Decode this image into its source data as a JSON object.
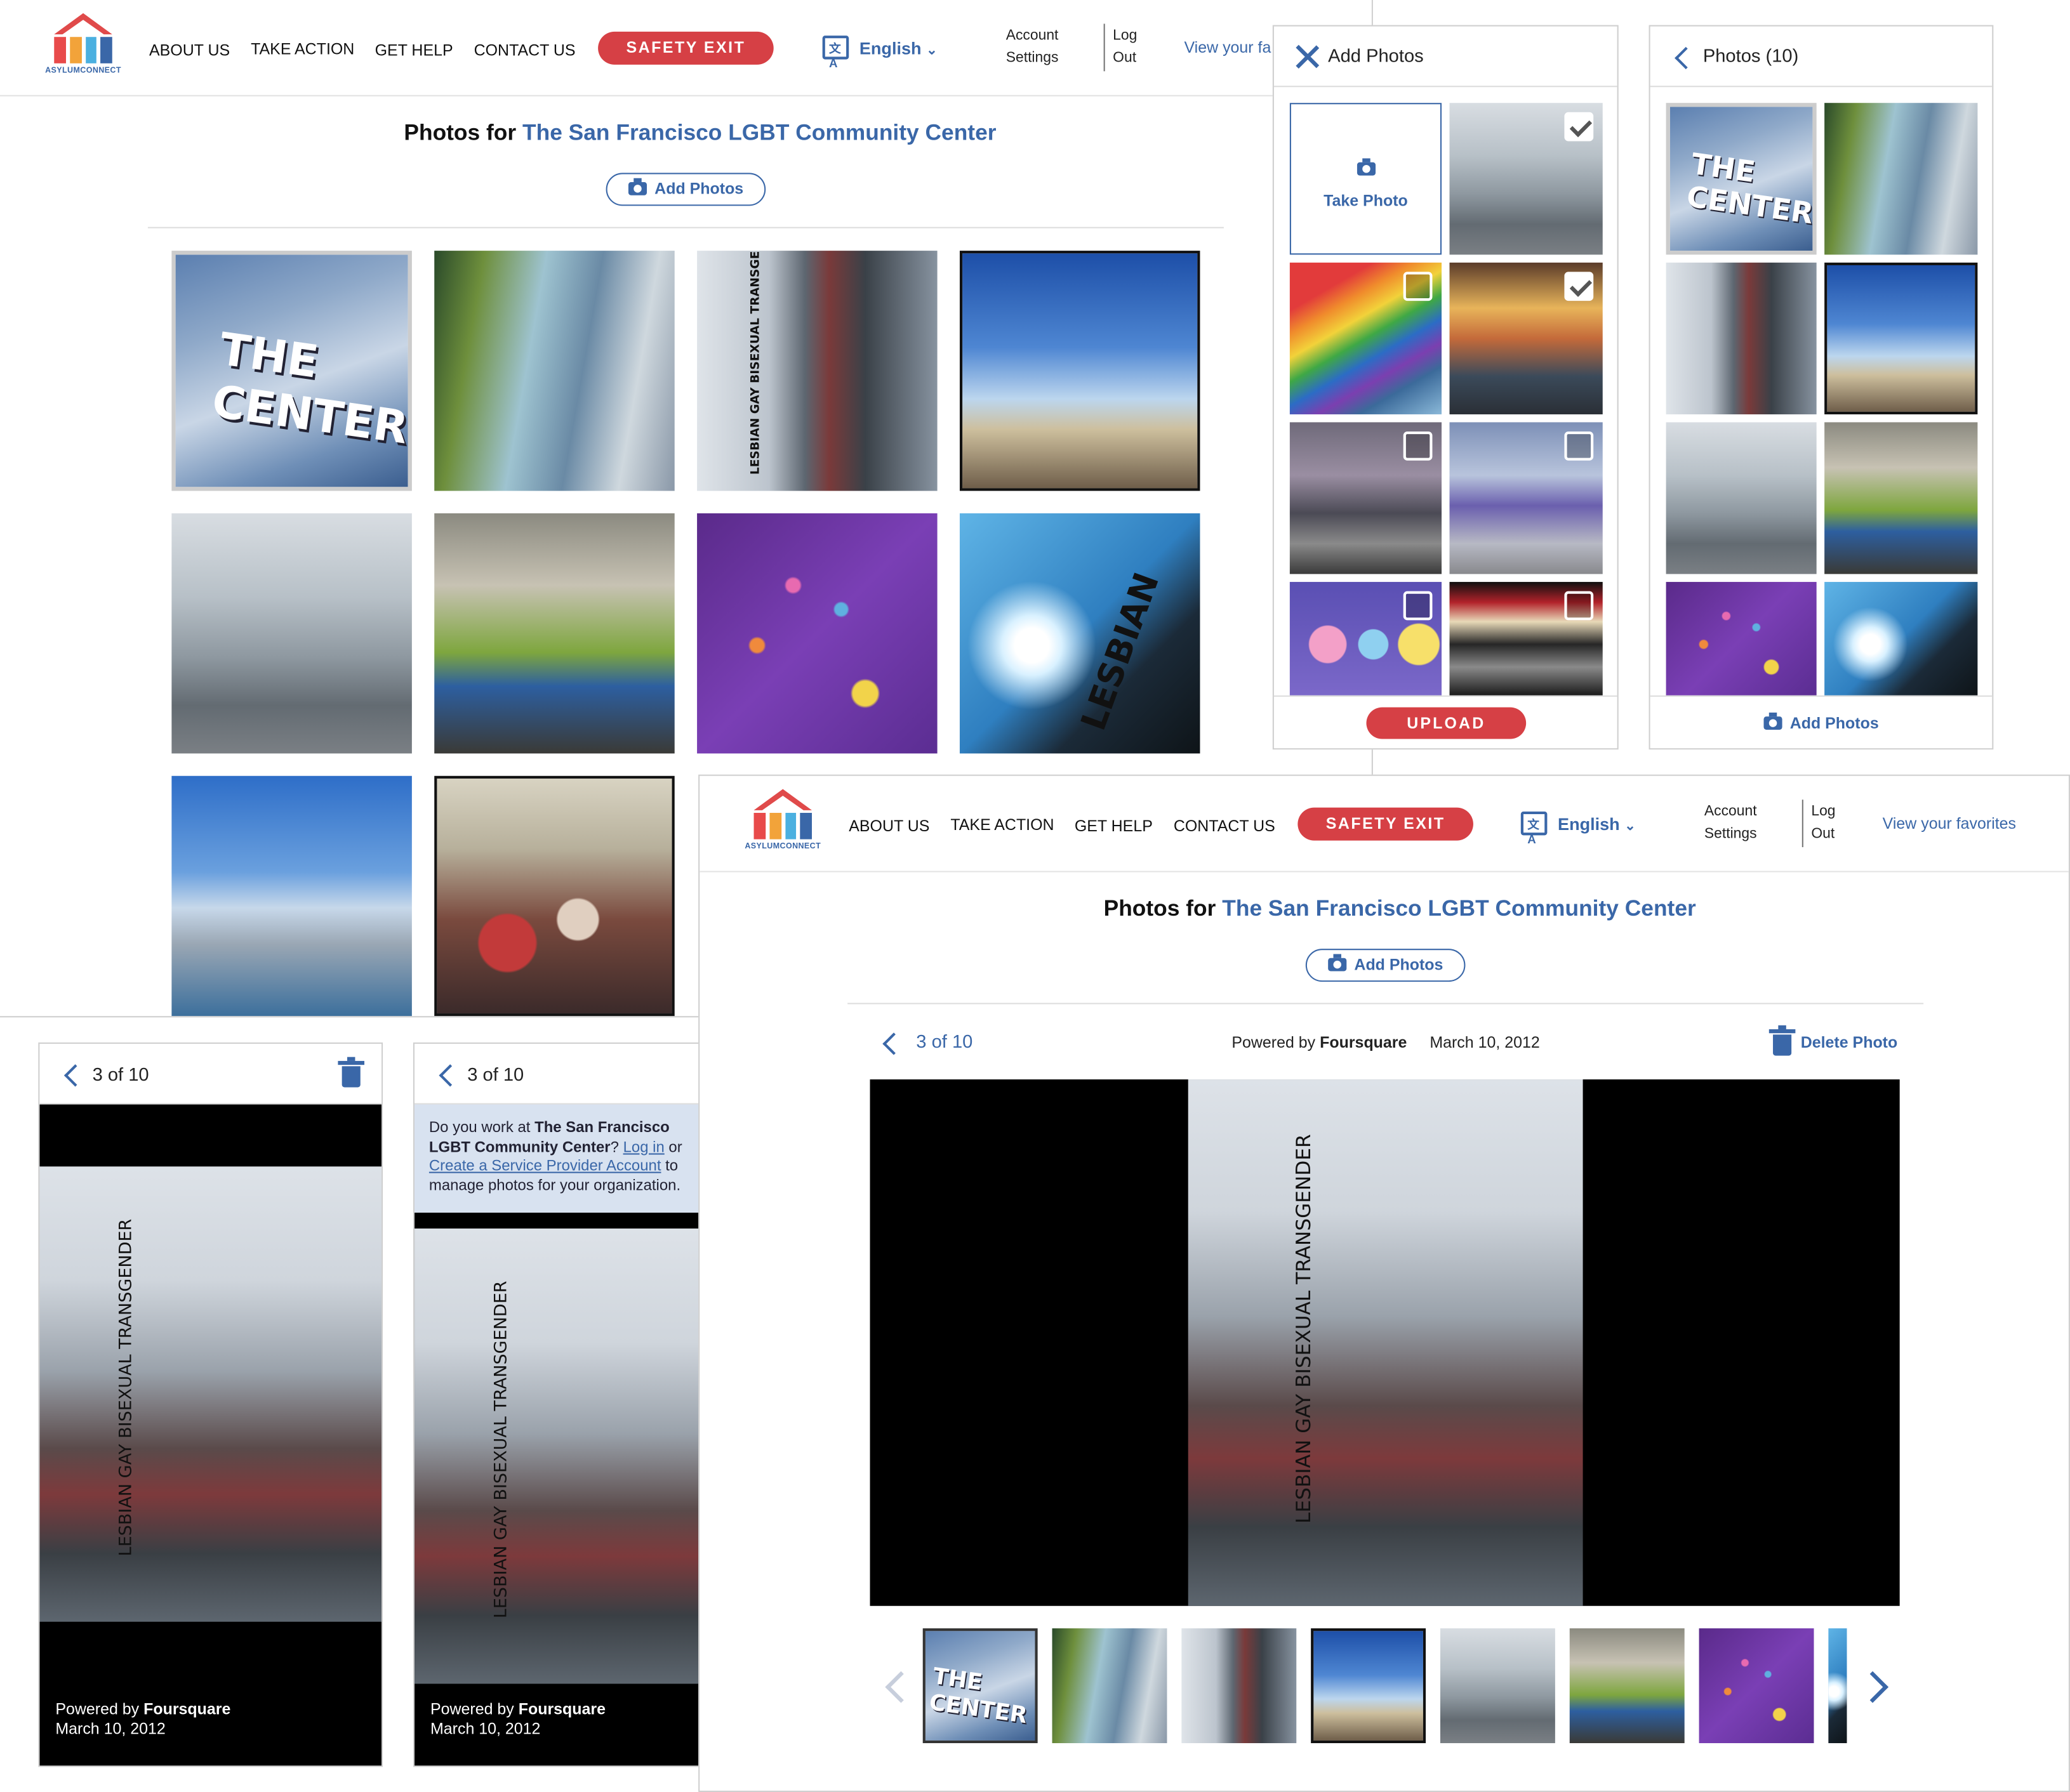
{
  "brand": {
    "logo_text": "ASYLUMCONNECT",
    "accent": "#3a67a8",
    "danger": "#d64045"
  },
  "header": {
    "nav": [
      "ABOUT US",
      "TAKE ACTION",
      "GET HELP",
      "CONTACT US"
    ],
    "safety_exit": "SAFETY EXIT",
    "language": "English",
    "account_line1": "Account",
    "account_line2": "Settings",
    "logout_line1": "Log",
    "logout_line2": "Out",
    "favorites": "View your favorites",
    "favorites_truncated": "View your fa"
  },
  "gallery": {
    "title_prefix": "Photos for",
    "org_name": "The San Francisco LGBT Community Center",
    "add_photos": "Add Photos",
    "photos": [
      {
        "name": "center-sign",
        "caption": "THE CENTER"
      },
      {
        "name": "cheerleaders",
        "caption": ""
      },
      {
        "name": "lamp-post-building",
        "caption": "LESBIAN GAY BISEXUAL TRANSGE"
      },
      {
        "name": "city-sky",
        "caption": ""
      },
      {
        "name": "glass-building",
        "caption": ""
      },
      {
        "name": "green-chairs",
        "caption": ""
      },
      {
        "name": "purple-stars",
        "caption": ""
      },
      {
        "name": "sunburst-sign",
        "caption": "LESBIAN"
      },
      {
        "name": "city-view",
        "caption": ""
      },
      {
        "name": "crowd",
        "caption": ""
      }
    ]
  },
  "add_photos_panel": {
    "title": "Add Photos",
    "take_photo": "Take Photo",
    "upload": "UPLOAD",
    "tiles": [
      {
        "name": "ceiling",
        "checked": true
      },
      {
        "name": "rainbow-flag",
        "checked": false
      },
      {
        "name": "library",
        "checked": true
      },
      {
        "name": "street-dog",
        "checked": false
      },
      {
        "name": "purple-building",
        "checked": false
      },
      {
        "name": "dolls",
        "checked": false
      },
      {
        "name": "poster",
        "checked": false
      }
    ]
  },
  "photos_panel": {
    "title": "Photos (10)",
    "add_photos": "Add Photos"
  },
  "viewer": {
    "counter": "3 of 10",
    "powered_by": "Powered by",
    "provider": "Foursquare",
    "date": "March 10, 2012",
    "delete": "Delete Photo",
    "photo_caption": "LESBIAN GAY BISEXUAL TRANSGENDER"
  },
  "notice": {
    "text1": "Do you work at",
    "org_bold": "The San Francisco LGBT Community Center",
    "text2": "?",
    "login": "Log in",
    "text3": "or",
    "create": "Create a Service Provider Account",
    "text4": "to manage photos for your organization."
  }
}
